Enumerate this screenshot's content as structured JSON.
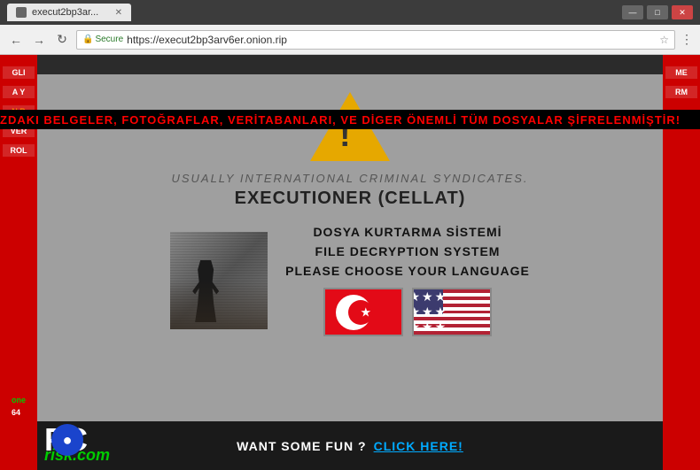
{
  "browser": {
    "url": "https://execut2bp3arv6er.onion.rip",
    "tab_label": "execut2bp3ar...",
    "secure_label": "Secure",
    "favicon_color": "#666"
  },
  "top_banner": {
    "text": "ZDAKI BELGELER, FOTOĞRAFLAR, VERİTABANLARI, VE DİGER  ÖNEMLİ  TÜM DOSYALAR ŞİFRELENMİŞTİR!"
  },
  "main": {
    "subtitle": "USUALLY INTERNATIONAL CRIMINAL SYNDICATES.",
    "title": "EXECUTIONER (CELLAT)",
    "line1": "DOSYA KURTARMA SİSTEMİ",
    "line2": "FILE DECRYPTION SYSTEM",
    "line3": "PLEASE CHOOSE YOUR LANGUAGE"
  },
  "bottom": {
    "want_text": "WANT SOME FUN ?",
    "click_text": "CLICK HERE!"
  },
  "side_left": {
    "items": [
      "GLI",
      "A Y",
      "N B",
      "VER",
      "ROL"
    ]
  },
  "side_right": {
    "items": [
      "ME",
      "RM",
      ""
    ]
  },
  "side_left_extra": [
    "one",
    "64"
  ],
  "pcrisk": {
    "pc": "PC",
    "risk": "risk",
    "com": ".com"
  }
}
